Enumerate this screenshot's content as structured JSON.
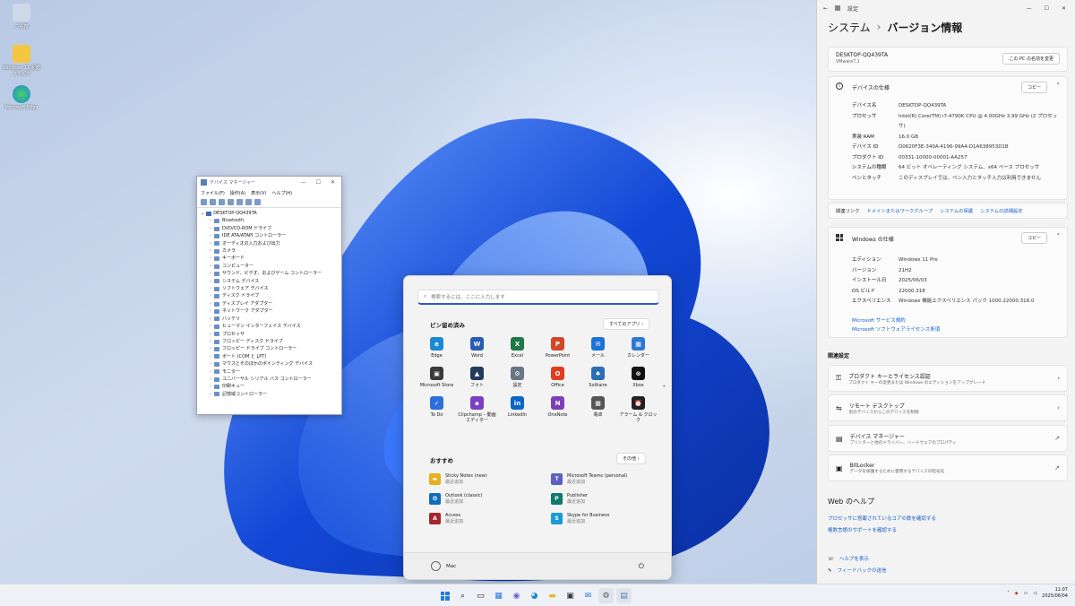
{
  "desktop": {
    "icons": [
      {
        "label": "ごみ箱"
      },
      {
        "label": "Windows 11 起動フォルダ"
      },
      {
        "label": "Microsoft Edge"
      }
    ]
  },
  "device_manager": {
    "title": "デバイス マネージャー",
    "menu": [
      "ファイル(F)",
      "操作(A)",
      "表示(V)",
      "ヘルプ(H)"
    ],
    "root": "DESKTOP-QQ439TA",
    "nodes": [
      "Bluetooth",
      "DVD/CD-ROM ドライブ",
      "IDE ATA/ATAPI コントローラー",
      "オーディオの入力および出力",
      "カメラ",
      "キーボード",
      "コンピューター",
      "サウンド、ビデオ、およびゲーム コントローラー",
      "システム デバイス",
      "ソフトウェア デバイス",
      "ディスク ドライブ",
      "ディスプレイ アダプター",
      "ネットワーク アダプター",
      "バッテリ",
      "ヒューマン インターフェイス デバイス",
      "プロセッサ",
      "フロッピー ディスク ドライブ",
      "フロッピー ドライブ コントローラー",
      "ポート (COM と LPT)",
      "マウスとそのほかのポインティング デバイス",
      "モニター",
      "ユニバーサル シリアル バス コントローラー",
      "印刷キュー",
      "記憶域コントローラー"
    ]
  },
  "start": {
    "search_placeholder": "検索するには、ここに入力します",
    "pinned_title": "ピン留め済み",
    "all_apps": "すべてのアプリ  ›",
    "apps": [
      {
        "label": "Edge",
        "color": "#1a8ad4",
        "glyph": "e"
      },
      {
        "label": "Word",
        "color": "#2b5cb5",
        "glyph": "W"
      },
      {
        "label": "Excel",
        "color": "#1d7a45",
        "glyph": "X"
      },
      {
        "label": "PowerPoint",
        "color": "#d24726",
        "glyph": "P"
      },
      {
        "label": "メール",
        "color": "#1d72d8",
        "glyph": "✉"
      },
      {
        "label": "カレンダー",
        "color": "#2b79d6",
        "glyph": "▦"
      },
      {
        "label": "Microsoft Store",
        "color": "#3a3a3a",
        "glyph": "▣"
      },
      {
        "label": "フォト",
        "color": "#243a5e",
        "glyph": "▲"
      },
      {
        "label": "設定",
        "color": "#6a7482",
        "glyph": "⚙"
      },
      {
        "label": "Office",
        "color": "#e03c1d",
        "glyph": "O"
      },
      {
        "label": "Solitaire",
        "color": "#2a6fb6",
        "glyph": "♠"
      },
      {
        "label": "Xbox",
        "color": "#111111",
        "glyph": "⊗"
      },
      {
        "label": "To Do",
        "color": "#2f6fdc",
        "glyph": "✓"
      },
      {
        "label": "Clipchamp – 動画エディター",
        "color": "#7a3fc3",
        "glyph": "▪"
      },
      {
        "label": "LinkedIn",
        "color": "#0a66c2",
        "glyph": "in"
      },
      {
        "label": "OneNote",
        "color": "#7b3fb8",
        "glyph": "N"
      },
      {
        "label": "電卓",
        "color": "#555555",
        "glyph": "▦"
      },
      {
        "label": "アラーム & クロック",
        "color": "#222222",
        "glyph": "⏰"
      }
    ],
    "recommended_title": "おすすめ",
    "more": "その他  ›",
    "recommended": [
      {
        "name": "Sticky Notes (new)",
        "sub": "最近追加",
        "color": "#e7b01e",
        "glyph": "▬"
      },
      {
        "name": "Microsoft Teams (personal)",
        "sub": "最近追加",
        "color": "#5b5fc7",
        "glyph": "T"
      },
      {
        "name": "Outlook (classic)",
        "sub": "最近追加",
        "color": "#0f6cbd",
        "glyph": "O"
      },
      {
        "name": "Publisher",
        "sub": "最近追加",
        "color": "#0e7a6b",
        "glyph": "P"
      },
      {
        "name": "Access",
        "sub": "最近追加",
        "color": "#a4262c",
        "glyph": "A"
      },
      {
        "name": "Skype for Business",
        "sub": "最近追加",
        "color": "#1a9bd7",
        "glyph": "S"
      }
    ],
    "user": "Mac"
  },
  "settings": {
    "title": "設定",
    "breadcrumb_parent": "システム",
    "breadcrumb_sep": "›",
    "breadcrumb_current": "バージョン情報",
    "pc_name": "DESKTOP-QQ439TA",
    "pc_model": "VMware7,1",
    "rename_button": "この PC の名前を変更",
    "device_spec_title": "デバイスの仕様",
    "copy": "コピー",
    "device_specs": [
      {
        "k": "デバイス名",
        "v": "DESKTOP-QQ439TA"
      },
      {
        "k": "プロセッサ",
        "v": "Intel(R) Core(TM) i7-4790K CPU @ 4.00GHz   3.99 GHz (2 プロセッサ)"
      },
      {
        "k": "実装 RAM",
        "v": "16.0 GB"
      },
      {
        "k": "デバイス ID",
        "v": "D0620F3E-340A-4196-99A4-D1A638953D1B"
      },
      {
        "k": "プロダクト ID",
        "v": "00331-10000-00001-AA257"
      },
      {
        "k": "システムの種類",
        "v": "64 ビット オペレーティング システム、x64 ベース プロセッサ"
      },
      {
        "k": "ペンとタッチ",
        "v": "このディスプレイでは、ペン入力とタッチ入力は利用できません"
      }
    ],
    "related_links_label": "関連リンク",
    "related_links": [
      "ドメインまたはワークグループ",
      "システムの保護",
      "システムの詳細設定"
    ],
    "windows_spec_title": "Windows の仕様",
    "windows_specs": [
      {
        "k": "エディション",
        "v": "Windows 11 Pro"
      },
      {
        "k": "バージョン",
        "v": "21H2"
      },
      {
        "k": "インストール日",
        "v": "2025/06/03"
      },
      {
        "k": "OS ビルド",
        "v": "22000.318"
      },
      {
        "k": "エクスペリエンス",
        "v": "Windows 機能エクスペリエンス パック 1000.22000.318.0"
      }
    ],
    "ms_links": [
      "Microsoft サービス規約",
      "Microsoft ソフトウェアライセンス条項"
    ],
    "related_settings_title": "関連設定",
    "related_settings": [
      {
        "title": "プロダクト キーとライセンス認証",
        "sub": "プロダクト キーの変更または Windows のエディションをアップグレード",
        "icon": "key-icon",
        "go": "›"
      },
      {
        "title": "リモート デスクトップ",
        "sub": "別のデバイスからこのデバイスを制御",
        "icon": "remote-desktop-icon",
        "go": "›"
      },
      {
        "title": "デバイス マネージャー",
        "sub": "プリンターと他のドライバー、ハードウェアのプロパティ",
        "icon": "device-manager-icon",
        "go": "↗"
      },
      {
        "title": "BitLocker",
        "sub": "データを保護するために使用するデバイスの暗号化",
        "icon": "bitlocker-icon",
        "go": "↗"
      }
    ],
    "web_help_title": "Web のヘルプ",
    "web_help_links": [
      "プロセッサに搭載されているコアの数を確認する",
      "複数言語のサポートを確認する"
    ],
    "footer_links": [
      "ヘルプを表示",
      "フィードバックの送信"
    ]
  },
  "taskbar": {
    "time": "11:07",
    "date": "2025/06/04"
  }
}
